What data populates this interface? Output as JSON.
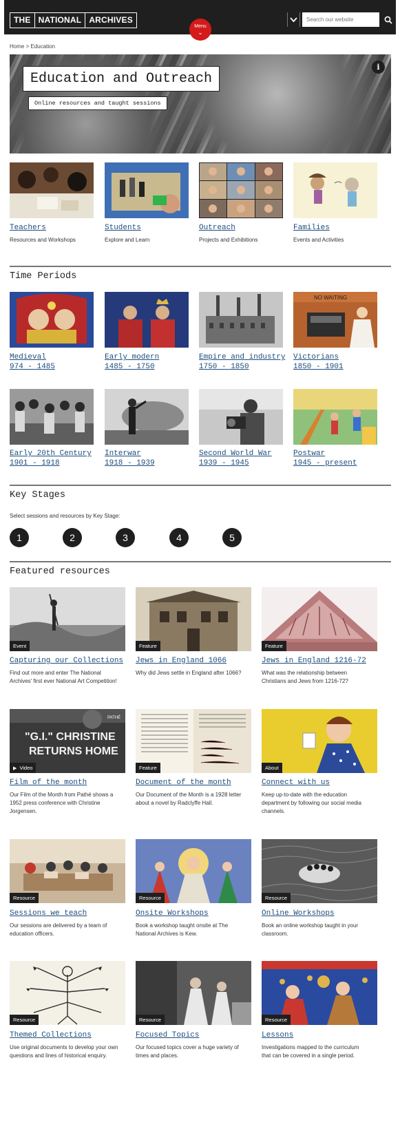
{
  "header": {
    "logo": [
      "THE",
      "NATIONAL",
      "ARCHIVES"
    ],
    "menu_label": "Menu",
    "search_placeholder": "Search our website"
  },
  "breadcrumb": {
    "home": "Home",
    "separator": ">",
    "current": "Education"
  },
  "hero": {
    "title": "Education and Outreach",
    "subtitle": "Online resources and taught sessions",
    "info_icon": "info-icon"
  },
  "audiences": [
    {
      "title": "Teachers",
      "desc": "Resources and Workshops"
    },
    {
      "title": "Students",
      "desc": "Explore and Learn"
    },
    {
      "title": "Outreach",
      "desc": "Projects and Exhibitions"
    },
    {
      "title": "Families",
      "desc": "Events and Activities"
    }
  ],
  "time_periods": {
    "heading": "Time Periods",
    "items": [
      {
        "title": "Medieval",
        "range": "974 - 1485"
      },
      {
        "title": "Early modern",
        "range": "1485 - 1750"
      },
      {
        "title": "Empire and industry",
        "range": "1750 - 1850"
      },
      {
        "title": "Victorians",
        "range": "1850 - 1901"
      },
      {
        "title": "Early 20th Century",
        "range": "1901 - 1918"
      },
      {
        "title": "Interwar",
        "range": "1918 - 1939"
      },
      {
        "title": "Second World War",
        "range": "1939 - 1945"
      },
      {
        "title": "Postwar",
        "range": "1945 - present"
      }
    ]
  },
  "key_stages": {
    "heading": "Key Stages",
    "intro": "Select sessions and resources by Key Stage:",
    "stages": [
      "1",
      "2",
      "3",
      "4",
      "5"
    ]
  },
  "featured": {
    "heading": "Featured resources",
    "items": [
      {
        "badge": "Event",
        "title": "Capturing our Collections",
        "desc1": "Find out more and enter The National",
        "desc2": "Archives' first ever National Art Competition!",
        "desc3": ""
      },
      {
        "badge": "Feature",
        "title": "Jews in England 1066",
        "desc1": "Why did Jews settle in England after 1066?",
        "desc2": "",
        "desc3": ""
      },
      {
        "badge": "Feature",
        "title": "Jews in England 1216-72",
        "desc1": "What was the relationship between",
        "desc2": "Christians and Jews from 1216-72?",
        "desc3": ""
      },
      {
        "badge": "Video",
        "title": "Film of the month",
        "desc1": "Our Film of the Month from Pathé shows a",
        "desc2": "1952 press conference with Christine",
        "desc3": "Jorgensen."
      },
      {
        "badge": "Feature",
        "title": "Document of the month",
        "desc1": "Our Document of the Month is a 1928 letter",
        "desc2": "about a novel by Radclyffe Hall.",
        "desc3": ""
      },
      {
        "badge": "About",
        "title": "Connect with us",
        "desc1": "Keep up-to-date with the education",
        "desc2": "department by following our social media",
        "desc3": "channels."
      },
      {
        "badge": "Resource",
        "title": "Sessions we teach",
        "desc1": "Our sessions are delivered by a team of",
        "desc2": "education officers.",
        "desc3": ""
      },
      {
        "badge": "Resource",
        "title": "Onsite Workshops",
        "desc1": "Book a workshop taught onsite at The",
        "desc2": "National Archives is Kew.",
        "desc3": ""
      },
      {
        "badge": "Resource",
        "title": "Online Workshops",
        "desc1": "Book an online workshop taught in your",
        "desc2": "classroom.",
        "desc3": ""
      },
      {
        "badge": "Resource",
        "title": "Themed Collections",
        "desc1": "Use original documents to develop your own",
        "desc2": "questions and lines of historical enquiry.",
        "desc3": ""
      },
      {
        "badge": "Resource",
        "title": "Focused Topics",
        "desc1": "Our focused topics cover a huge variety of",
        "desc2": "times and places.",
        "desc3": ""
      },
      {
        "badge": "Resource",
        "title": "Lessons",
        "desc1": "Investigations mapped to the curriculum",
        "desc2": "that can be covered in a single period.",
        "desc3": ""
      }
    ]
  },
  "film_overlay": {
    "line1": "\"G.I.\" CHRISTINE",
    "line2": "RETURNS HOME",
    "brand": "PATHÉ"
  },
  "victorians_sign": "NO WAITING",
  "colors": {
    "header_bg": "#1f1f1f",
    "menu_red": "#d41a1a",
    "link_blue": "#1c4c7c"
  }
}
